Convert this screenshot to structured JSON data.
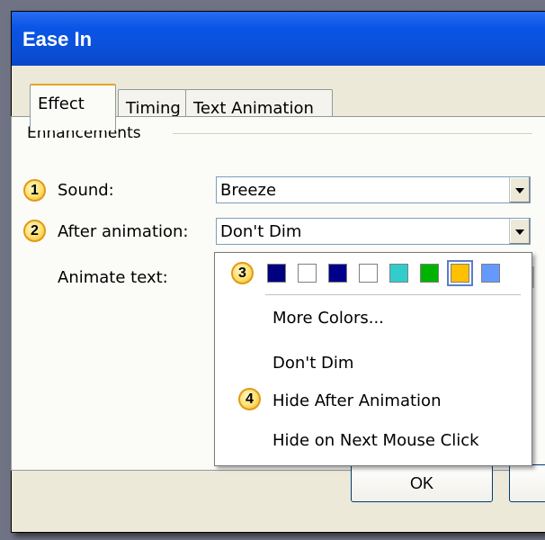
{
  "dialog": {
    "title": "Ease In",
    "tabs": [
      "Effect",
      "Timing",
      "Text Animation"
    ],
    "section_label": "Enhancements",
    "sound": {
      "badge": "1",
      "label": "Sound:",
      "value": "Breeze"
    },
    "after_animation": {
      "badge": "2",
      "label": "After animation:",
      "value": "Don't Dim"
    },
    "animate_text": {
      "label": "Animate text:"
    },
    "ok_label": "OK"
  },
  "dropdown": {
    "badge_colors": "3",
    "colors": [
      "#000080",
      "#ffffff",
      "#00008b",
      "#ffffff",
      "#33cccc",
      "#00b300",
      "#ffc000",
      "#6699ff"
    ],
    "selected_index": 6,
    "more_colors": "More Colors...",
    "dont_dim": "Don't Dim",
    "badge_hide": "4",
    "hide_after": "Hide After Animation",
    "hide_next_click": "Hide on Next Mouse Click"
  }
}
